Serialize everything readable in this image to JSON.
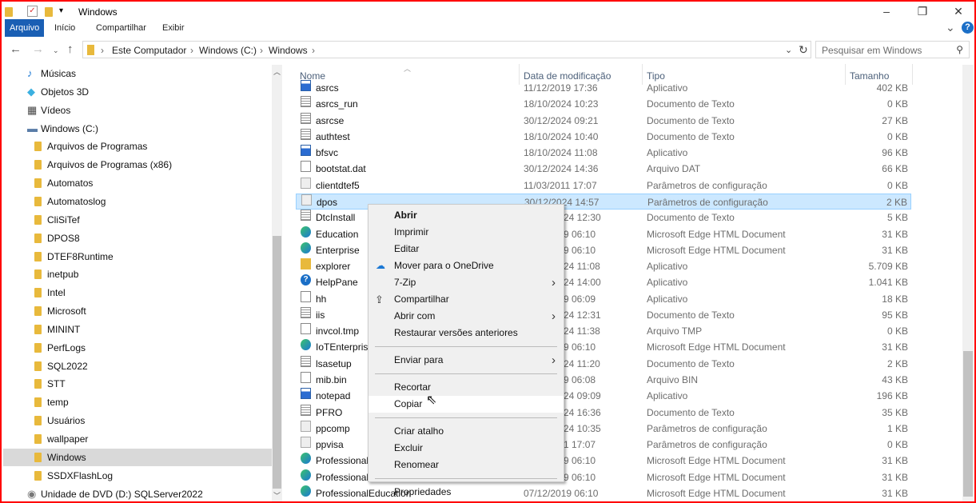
{
  "window": {
    "title": "Windows",
    "minimize": "–",
    "maximize": "❐",
    "close": "✕"
  },
  "ribbon": {
    "tabs": [
      "Arquivo",
      "Início",
      "Compartilhar",
      "Exibir"
    ],
    "expand": "⌄",
    "help": "?"
  },
  "address": {
    "crumbs": [
      "Este Computador",
      "Windows (C:)",
      "Windows"
    ],
    "search_placeholder": "Pesquisar em Windows"
  },
  "sidebar": {
    "items": [
      {
        "label": "Músicas",
        "icon": "music-icon",
        "indent": 1
      },
      {
        "label": "Objetos 3D",
        "icon": "cube-icon",
        "indent": 1
      },
      {
        "label": "Vídeos",
        "icon": "video-icon",
        "indent": 1
      },
      {
        "label": "Windows (C:)",
        "icon": "drive-icon",
        "indent": 1
      },
      {
        "label": "Arquivos de Programas",
        "icon": "folder-icon",
        "indent": 2
      },
      {
        "label": "Arquivos de Programas (x86)",
        "icon": "folder-icon",
        "indent": 2
      },
      {
        "label": "Automatos",
        "icon": "folder-icon",
        "indent": 2
      },
      {
        "label": "Automatoslog",
        "icon": "folder-icon",
        "indent": 2
      },
      {
        "label": "CliSiTef",
        "icon": "folder-icon",
        "indent": 2
      },
      {
        "label": "DPOS8",
        "icon": "folder-icon",
        "indent": 2
      },
      {
        "label": "DTEF8Runtime",
        "icon": "folder-icon",
        "indent": 2
      },
      {
        "label": "inetpub",
        "icon": "folder-icon",
        "indent": 2
      },
      {
        "label": "Intel",
        "icon": "folder-icon",
        "indent": 2
      },
      {
        "label": "Microsoft",
        "icon": "folder-icon",
        "indent": 2
      },
      {
        "label": "MININT",
        "icon": "folder-icon",
        "indent": 2
      },
      {
        "label": "PerfLogs",
        "icon": "folder-icon",
        "indent": 2
      },
      {
        "label": "SQL2022",
        "icon": "folder-icon",
        "indent": 2
      },
      {
        "label": "STT",
        "icon": "folder-icon",
        "indent": 2
      },
      {
        "label": "temp",
        "icon": "folder-icon",
        "indent": 2
      },
      {
        "label": "Usuários",
        "icon": "folder-icon",
        "indent": 2
      },
      {
        "label": "wallpaper",
        "icon": "folder-icon",
        "indent": 2
      },
      {
        "label": "Windows",
        "icon": "folder-icon",
        "indent": 2,
        "selected": true
      },
      {
        "label": "SSDXFlashLog",
        "icon": "folder-icon",
        "indent": 2
      },
      {
        "label": "Unidade de DVD (D:) SQLServer2022",
        "icon": "dvd-icon",
        "indent": 1
      }
    ]
  },
  "columns": {
    "name": "Nome",
    "date": "Data de modificação",
    "type": "Tipo",
    "size": "Tamanho"
  },
  "files": [
    {
      "name": "asrcs",
      "date": "11/12/2019 17:36",
      "type": "Aplicativo",
      "size": "402 KB",
      "icon": "app"
    },
    {
      "name": "asrcs_run",
      "date": "18/10/2024 10:23",
      "type": "Documento de Texto",
      "size": "0 KB",
      "icon": "txt"
    },
    {
      "name": "asrcse",
      "date": "30/12/2024 09:21",
      "type": "Documento de Texto",
      "size": "27 KB",
      "icon": "txt"
    },
    {
      "name": "authtest",
      "date": "18/10/2024 10:40",
      "type": "Documento de Texto",
      "size": "0 KB",
      "icon": "txt"
    },
    {
      "name": "bfsvc",
      "date": "18/10/2024 11:08",
      "type": "Aplicativo",
      "size": "96 KB",
      "icon": "app"
    },
    {
      "name": "bootstat.dat",
      "date": "30/12/2024 14:36",
      "type": "Arquivo DAT",
      "size": "66 KB",
      "icon": "file"
    },
    {
      "name": "clientdtef5",
      "date": "11/03/2011 17:07",
      "type": "Parâmetros de configuração",
      "size": "0 KB",
      "icon": "cfg"
    },
    {
      "name": "dpos",
      "date": "30/12/2024 14:57",
      "type": "Parâmetros de configuração",
      "size": "2 KB",
      "icon": "cfg",
      "selected": true
    },
    {
      "name": "DtcInstall",
      "date": "24 12:30",
      "partial": true,
      "type": "Documento de Texto",
      "size": "5 KB",
      "icon": "txt"
    },
    {
      "name": "Education",
      "date": "9 06:10",
      "partial": true,
      "type": "Microsoft Edge HTML Document",
      "size": "31 KB",
      "icon": "edge"
    },
    {
      "name": "Enterprise",
      "date": "9 06:10",
      "partial": true,
      "type": "Microsoft Edge HTML Document",
      "size": "31 KB",
      "icon": "edge"
    },
    {
      "name": "explorer",
      "date": "24 11:08",
      "partial": true,
      "type": "Aplicativo",
      "size": "5.709 KB",
      "icon": "folder"
    },
    {
      "name": "HelpPane",
      "date": "24 14:00",
      "partial": true,
      "type": "Aplicativo",
      "size": "1.041 KB",
      "icon": "help"
    },
    {
      "name": "hh",
      "date": "9 06:09",
      "partial": true,
      "type": "Aplicativo",
      "size": "18 KB",
      "icon": "file"
    },
    {
      "name": "iis",
      "date": "24 12:31",
      "partial": true,
      "type": "Documento de Texto",
      "size": "95 KB",
      "icon": "txt"
    },
    {
      "name": "invcol.tmp",
      "date": "24 11:38",
      "partial": true,
      "type": "Arquivo TMP",
      "size": "0 KB",
      "icon": "file"
    },
    {
      "name": "IoTEnterprise",
      "date": "9 06:10",
      "partial": true,
      "type": "Microsoft Edge HTML Document",
      "size": "31 KB",
      "icon": "edge"
    },
    {
      "name": "lsasetup",
      "date": "24 11:20",
      "partial": true,
      "type": "Documento de Texto",
      "size": "2 KB",
      "icon": "txt"
    },
    {
      "name": "mib.bin",
      "date": "9 06:08",
      "partial": true,
      "type": "Arquivo BIN",
      "size": "43 KB",
      "icon": "file"
    },
    {
      "name": "notepad",
      "date": "24 09:09",
      "partial": true,
      "type": "Aplicativo",
      "size": "196 KB",
      "icon": "app"
    },
    {
      "name": "PFRO",
      "date": "24 16:36",
      "partial": true,
      "type": "Documento de Texto",
      "size": "35 KB",
      "icon": "txt"
    },
    {
      "name": "ppcomp",
      "date": "24 10:35",
      "partial": true,
      "type": "Parâmetros de configuração",
      "size": "1 KB",
      "icon": "cfg"
    },
    {
      "name": "ppvisa",
      "date": "1 17:07",
      "partial": true,
      "type": "Parâmetros de configuração",
      "size": "0 KB",
      "icon": "cfg"
    },
    {
      "name": "Professional",
      "date": "9 06:10",
      "partial": true,
      "type": "Microsoft Edge HTML Document",
      "size": "31 KB",
      "icon": "edge"
    },
    {
      "name": "ProfessionalC",
      "date": "9 06:10",
      "partial": true,
      "type": "Microsoft Edge HTML Document",
      "size": "31 KB",
      "icon": "edge"
    },
    {
      "name": "ProfessionalEducation",
      "date": "07/12/2019 06:10",
      "type": "Microsoft Edge HTML Document",
      "size": "31 KB",
      "icon": "edge"
    }
  ],
  "context_menu": {
    "items": [
      {
        "label": "Abrir",
        "bold": true
      },
      {
        "label": "Imprimir"
      },
      {
        "label": "Editar"
      },
      {
        "label": "Mover para o OneDrive",
        "icon": "onedrive-icon"
      },
      {
        "label": "7-Zip",
        "submenu": true
      },
      {
        "label": "Compartilhar",
        "icon": "share-icon"
      },
      {
        "label": "Abrir com",
        "submenu": true
      },
      {
        "label": "Restaurar versões anteriores",
        "sep_after": true
      },
      {
        "label": "Enviar para",
        "submenu": true,
        "sep_after": true
      },
      {
        "label": "Recortar"
      },
      {
        "label": "Copiar",
        "hover": true,
        "sep_after": true
      },
      {
        "label": "Criar atalho"
      },
      {
        "label": "Excluir"
      },
      {
        "label": "Renomear",
        "sep_after": true
      },
      {
        "label": "Propriedades"
      }
    ]
  },
  "colors": {
    "accent": "#1a5fb4",
    "selection": "#cce8ff",
    "border": "#ff0000"
  }
}
